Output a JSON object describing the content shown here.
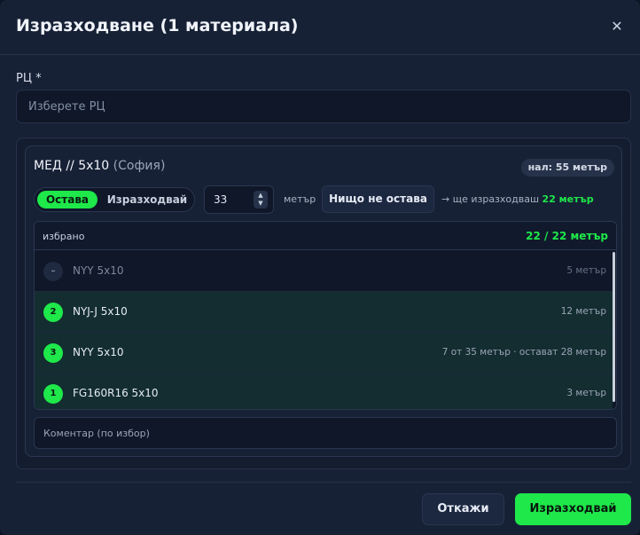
{
  "dialog": {
    "title": "Изразходване (1 материала)",
    "close_glyph": "✕"
  },
  "rc": {
    "label": "РЦ *",
    "placeholder": "Изберете РЦ"
  },
  "material": {
    "name": "МЕД // 5x10",
    "city": "(София)",
    "stock_badge": "нал: 55 метър",
    "mode_options": [
      "Остава",
      "Изразходвай"
    ],
    "active_mode": "Остава",
    "quantity": "33",
    "unit": "метър",
    "nothing_left_label": "Нищо не остава",
    "consume_note_prefix": "→ ще изразходваш",
    "consume_note_amount": "22 метър",
    "list": {
      "header_label": "избрано",
      "header_total": "22 / 22 метър",
      "rows": [
        {
          "badge": "–",
          "name": "NYY 5x10",
          "detail": "5 метър",
          "selected": false
        },
        {
          "badge": "2",
          "name": "NYJ-J 5x10",
          "detail": "12 метър",
          "selected": true
        },
        {
          "badge": "3",
          "name": "NYY 5x10",
          "detail": "7 от 35 метър · остават 28 метър",
          "selected": true
        },
        {
          "badge": "1",
          "name": "FG160R16 5x10",
          "detail": "3 метър",
          "selected": true
        }
      ]
    },
    "comment_placeholder": "Коментар (по избор)"
  },
  "footer": {
    "cancel_label": "Откажи",
    "confirm_label": "Изразходвай"
  },
  "colors": {
    "accent": "#1ee84a",
    "background": "#172136",
    "selected_row": "#132d30"
  },
  "icons": {
    "close": "close-icon",
    "stepper": "chevron-up-down-icon"
  }
}
